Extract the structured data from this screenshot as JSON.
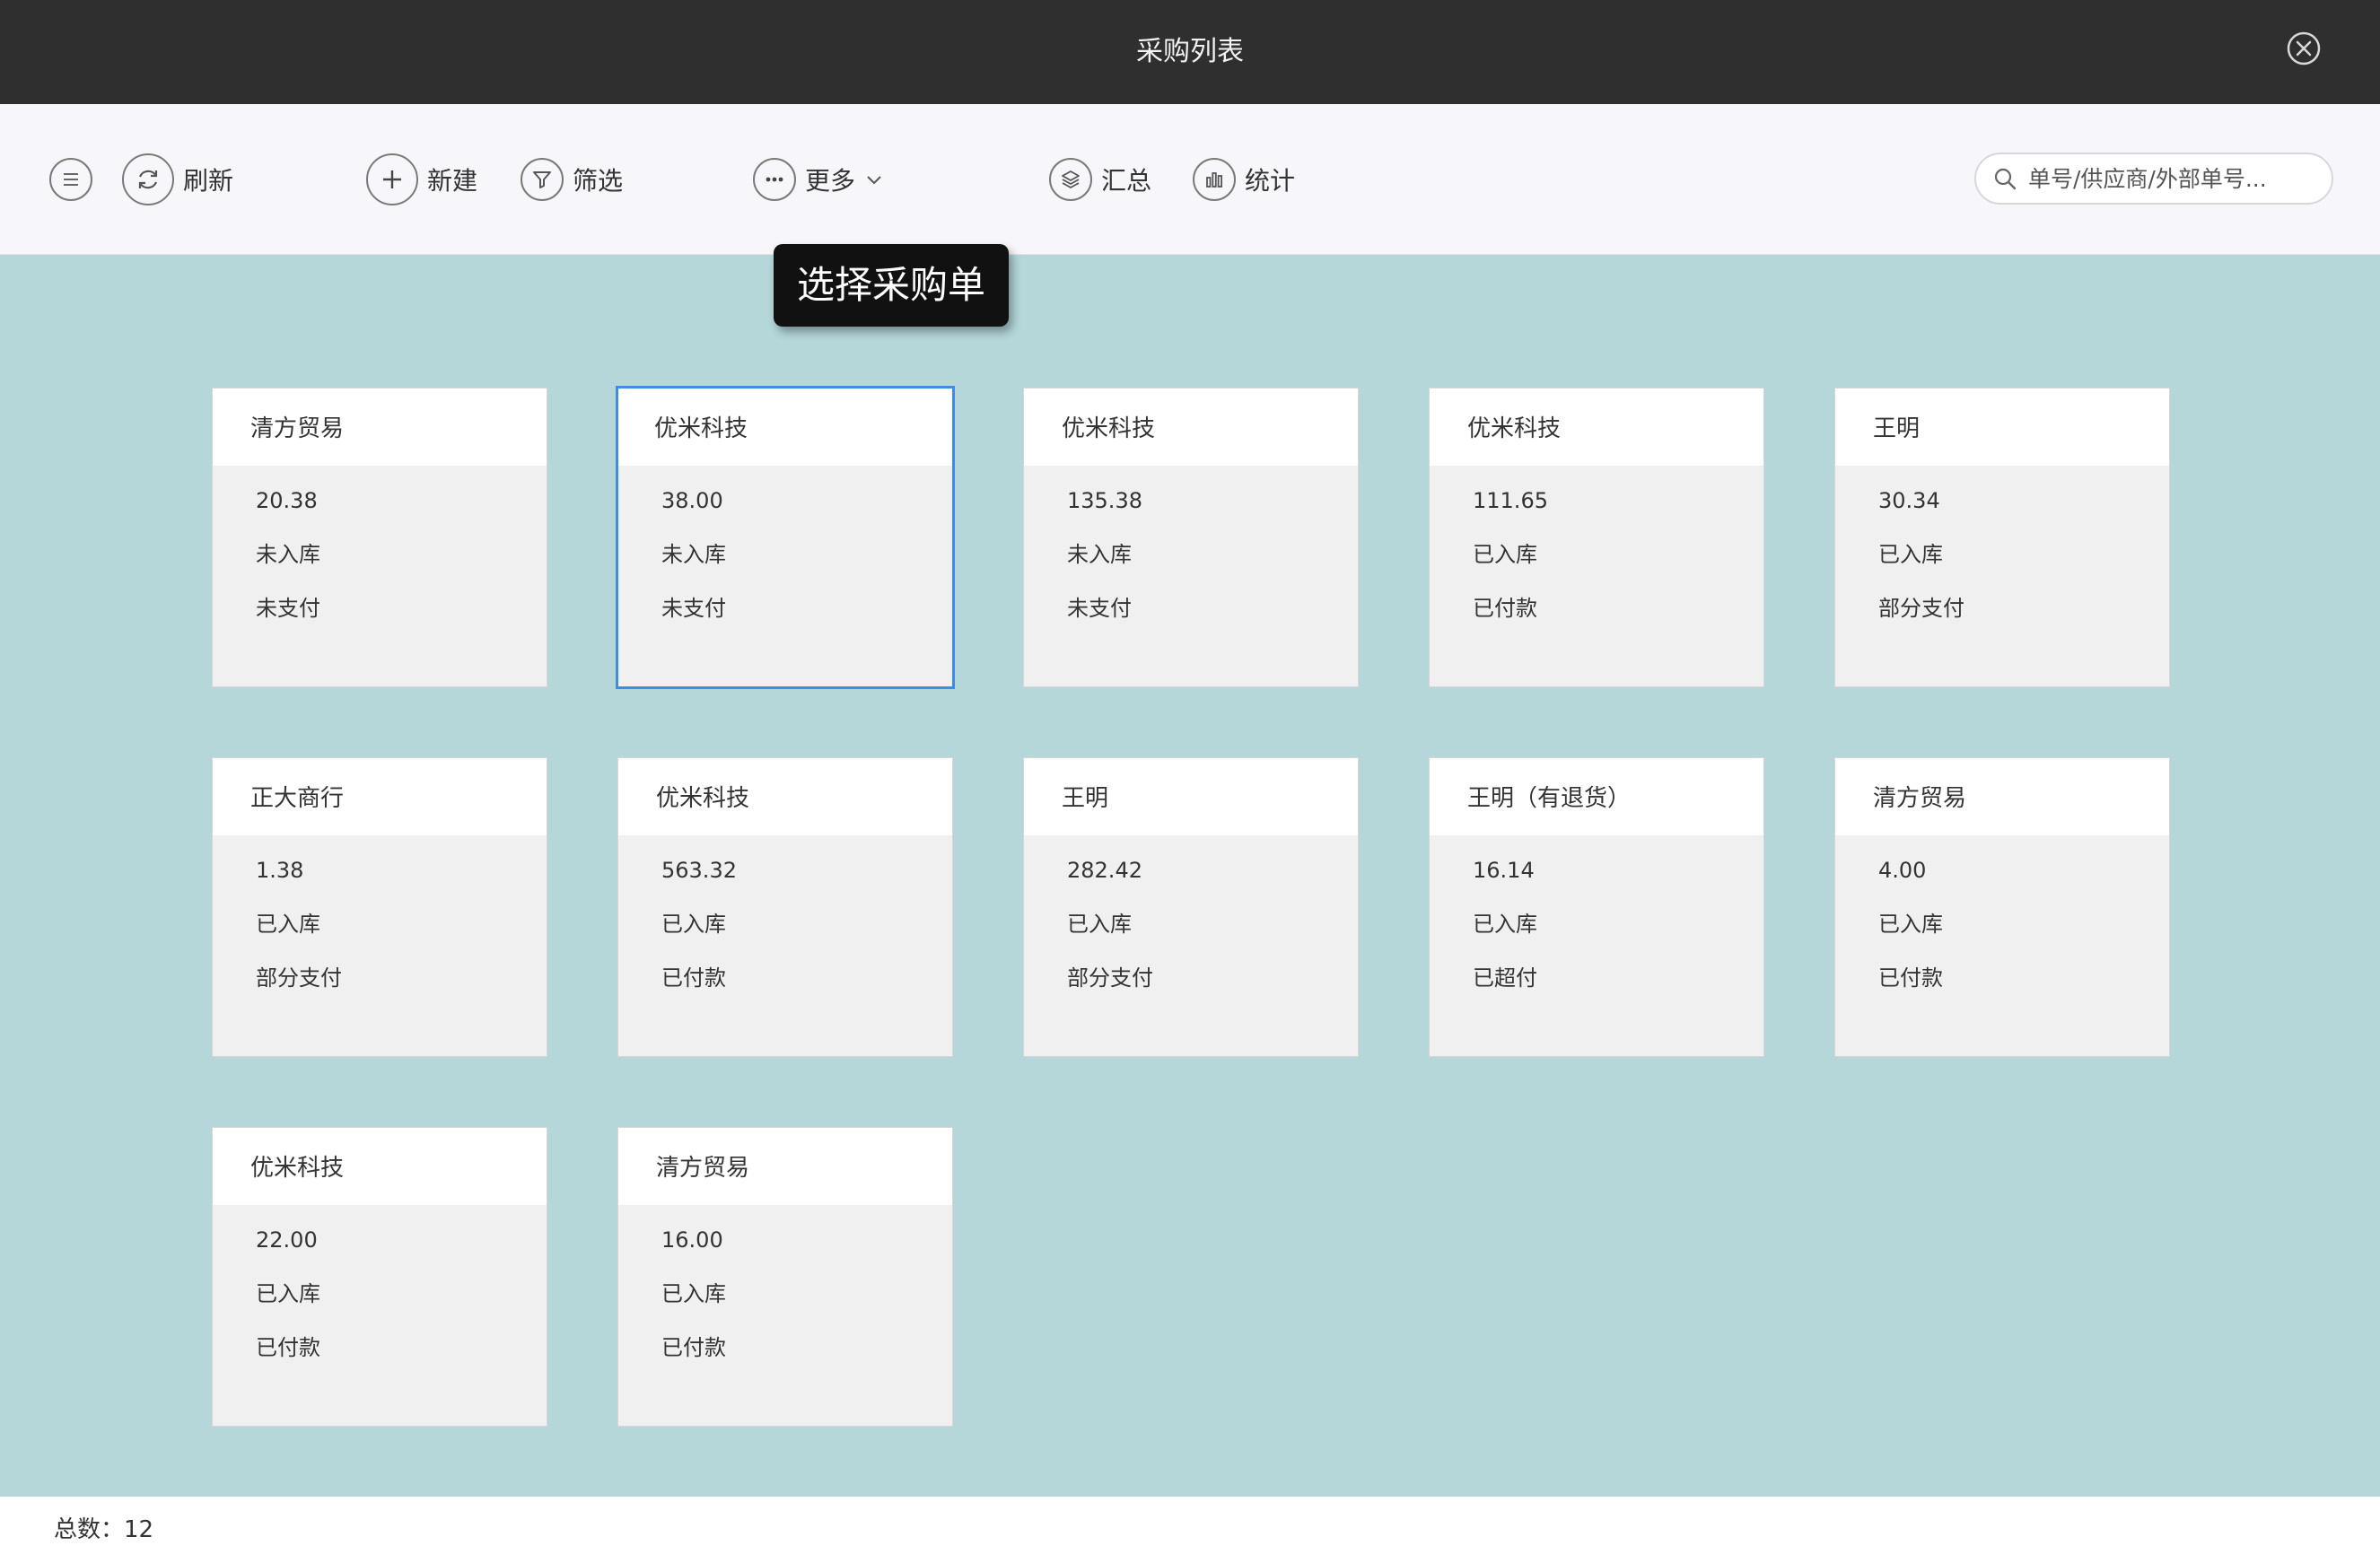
{
  "window": {
    "title": "采购列表"
  },
  "toolbar": {
    "refresh_label": "刷新",
    "new_label": "新建",
    "filter_label": "筛选",
    "more_label": "更多",
    "summary_label": "汇总",
    "stats_label": "统计"
  },
  "search": {
    "placeholder": "单号/供应商/外部单号..."
  },
  "tooltip": {
    "text": "选择采购单"
  },
  "cards": [
    {
      "supplier": "清方贸易",
      "amount": "20.38",
      "stock_status": "未入库",
      "pay_status": "未支付"
    },
    {
      "supplier": "优米科技",
      "amount": "38.00",
      "stock_status": "未入库",
      "pay_status": "未支付",
      "selected": true
    },
    {
      "supplier": "优米科技",
      "amount": "135.38",
      "stock_status": "未入库",
      "pay_status": "未支付"
    },
    {
      "supplier": "优米科技",
      "amount": "111.65",
      "stock_status": "已入库",
      "pay_status": "已付款"
    },
    {
      "supplier": "王明",
      "amount": "30.34",
      "stock_status": "已入库",
      "pay_status": "部分支付"
    },
    {
      "supplier": "正大商行",
      "amount": "1.38",
      "stock_status": "已入库",
      "pay_status": "部分支付"
    },
    {
      "supplier": "优米科技",
      "amount": "563.32",
      "stock_status": "已入库",
      "pay_status": "已付款"
    },
    {
      "supplier": "王明",
      "amount": "282.42",
      "stock_status": "已入库",
      "pay_status": "部分支付"
    },
    {
      "supplier": "王明（有退货）",
      "amount": "16.14",
      "stock_status": "已入库",
      "pay_status": "已超付"
    },
    {
      "supplier": "清方贸易",
      "amount": "4.00",
      "stock_status": "已入库",
      "pay_status": "已付款"
    },
    {
      "supplier": "优米科技",
      "amount": "22.00",
      "stock_status": "已入库",
      "pay_status": "已付款"
    },
    {
      "supplier": "清方贸易",
      "amount": "16.00",
      "stock_status": "已入库",
      "pay_status": "已付款"
    }
  ],
  "footer": {
    "total_text": "总数：12"
  },
  "colors": {
    "titlebar": "#2f2f2f",
    "background": "#b5d7da",
    "selected_border": "#3a8ee6"
  },
  "icons": [
    "close-icon",
    "menu-icon",
    "refresh-icon",
    "plus-icon",
    "filter-icon",
    "more-icon",
    "chevron-down-icon",
    "layers-icon",
    "bar-chart-icon",
    "search-icon"
  ]
}
